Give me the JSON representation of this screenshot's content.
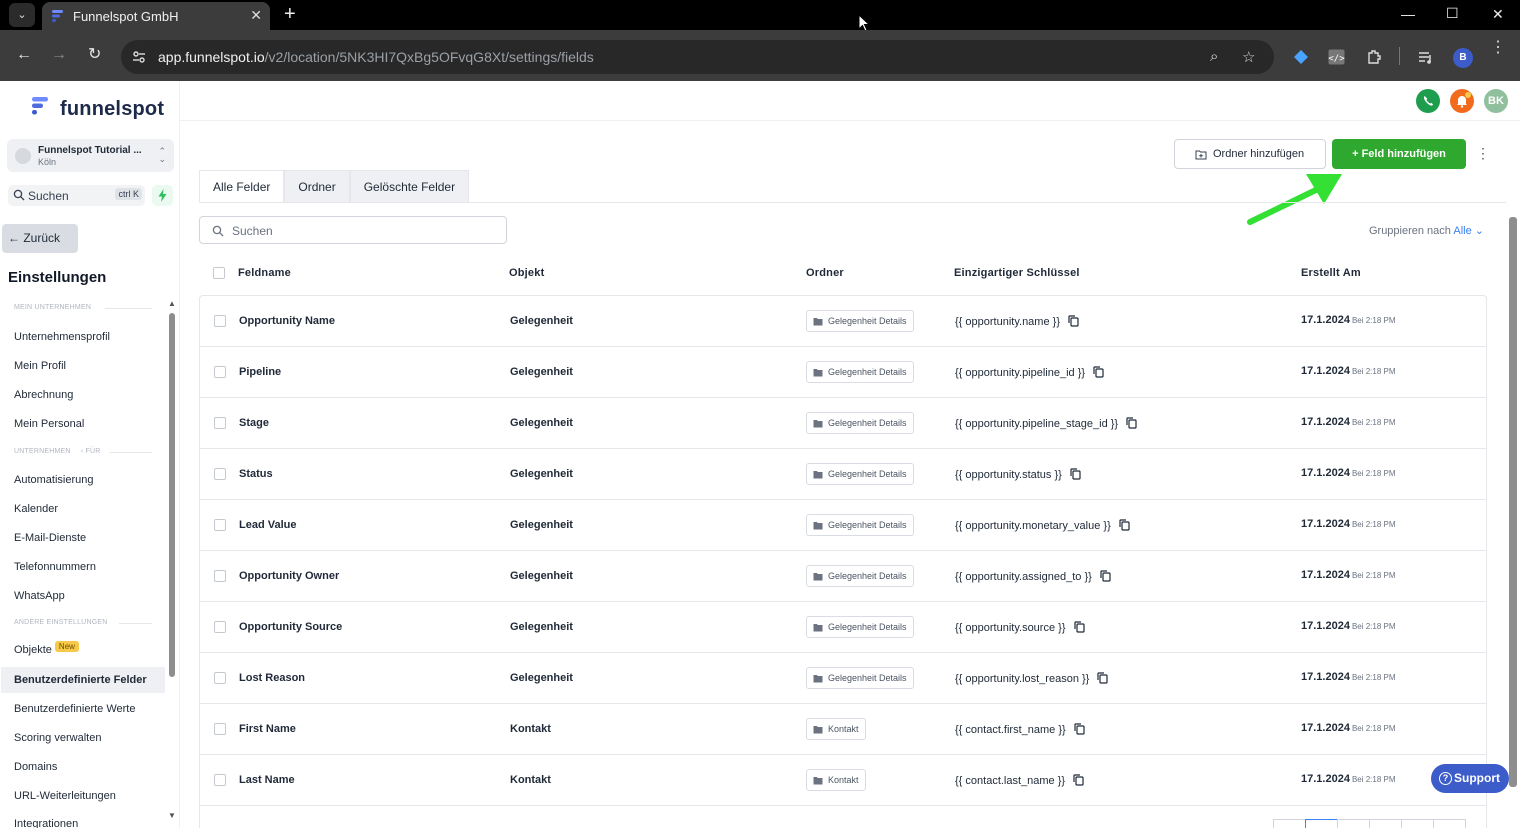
{
  "browser": {
    "tab_title": "Funnelspot GmbH",
    "url_host": "app.funnelspot.io",
    "url_path": "/v2/location/5NK3HI7QxBg5OFvqG8Xt/settings/fields",
    "profile_initial": "B"
  },
  "brand": {
    "name": "funnelspot",
    "accent": "#3b5cc9"
  },
  "header": {
    "avatar_initials": "BK"
  },
  "sidebar": {
    "location_name": "Funnelspot Tutorial ...",
    "location_city": "Köln",
    "search_placeholder": "Suchen",
    "search_shortcut": "ctrl K",
    "back_label": "← Zurück",
    "heading": "Einstellungen",
    "sections": [
      {
        "label": "MEIN UNTERNEHMEN"
      },
      {
        "label": "UNTERNEHMEN",
        "suffix": "‹ FÜR"
      },
      {
        "label": "ANDERE EINSTELLUNGEN"
      }
    ],
    "items": [
      "Unternehmensprofil",
      "Mein Profil",
      "Abrechnung",
      "Mein Personal",
      "Automatisierung",
      "Kalender",
      "E-Mail-Dienste",
      "Telefonnummern",
      "WhatsApp",
      "Objekte",
      "Benutzerdefinierte Felder",
      "Benutzerdefinierte Werte",
      "Scoring verwalten",
      "Domains",
      "URL-Weiterleitungen",
      "Integrationen"
    ],
    "new_badge": "New"
  },
  "actions": {
    "add_folder": "Ordner hinzufügen",
    "add_field": "+ Feld hinzufügen"
  },
  "tabs": [
    "Alle Felder",
    "Ordner",
    "Gelöschte Felder"
  ],
  "search_placeholder": "Suchen",
  "group_by": {
    "label": "Gruppieren nach",
    "value": "Alle"
  },
  "table": {
    "columns": [
      "Feldname",
      "Objekt",
      "Ordner",
      "Einzigartiger Schlüssel",
      "Erstellt Am"
    ],
    "rows": [
      {
        "name": "Opportunity Name",
        "object": "Gelegenheit",
        "folder": "Gelegenheit Details",
        "key": "{{ opportunity.name }}",
        "date": "17.1.2024",
        "time": "Bei 2:18 PM"
      },
      {
        "name": "Pipeline",
        "object": "Gelegenheit",
        "folder": "Gelegenheit Details",
        "key": "{{ opportunity.pipeline_id }}",
        "date": "17.1.2024",
        "time": "Bei 2:18 PM"
      },
      {
        "name": "Stage",
        "object": "Gelegenheit",
        "folder": "Gelegenheit Details",
        "key": "{{ opportunity.pipeline_stage_id }}",
        "date": "17.1.2024",
        "time": "Bei 2:18 PM"
      },
      {
        "name": "Status",
        "object": "Gelegenheit",
        "folder": "Gelegenheit Details",
        "key": "{{ opportunity.status }}",
        "date": "17.1.2024",
        "time": "Bei 2:18 PM"
      },
      {
        "name": "Lead Value",
        "object": "Gelegenheit",
        "folder": "Gelegenheit Details",
        "key": "{{ opportunity.monetary_value }}",
        "date": "17.1.2024",
        "time": "Bei 2:18 PM"
      },
      {
        "name": "Opportunity Owner",
        "object": "Gelegenheit",
        "folder": "Gelegenheit Details",
        "key": "{{ opportunity.assigned_to }}",
        "date": "17.1.2024",
        "time": "Bei 2:18 PM"
      },
      {
        "name": "Opportunity Source",
        "object": "Gelegenheit",
        "folder": "Gelegenheit Details",
        "key": "{{ opportunity.source }}",
        "date": "17.1.2024",
        "time": "Bei 2:18 PM"
      },
      {
        "name": "Lost Reason",
        "object": "Gelegenheit",
        "folder": "Gelegenheit Details",
        "key": "{{ opportunity.lost_reason }}",
        "date": "17.1.2024",
        "time": "Bei 2:18 PM"
      },
      {
        "name": "First Name",
        "object": "Kontakt",
        "folder": "Kontakt",
        "key": "{{ contact.first_name }}",
        "date": "17.1.2024",
        "time": "Bei 2:18 PM"
      },
      {
        "name": "Last Name",
        "object": "Kontakt",
        "folder": "Kontakt",
        "key": "{{ contact.last_name }}",
        "date": "17.1.2024",
        "time": "Bei 2:18 PM"
      }
    ]
  },
  "support_label": "Support",
  "colors": {
    "primary_green": "#2fa82f",
    "link_blue": "#3b82f6",
    "arrow_green": "#33e033"
  }
}
